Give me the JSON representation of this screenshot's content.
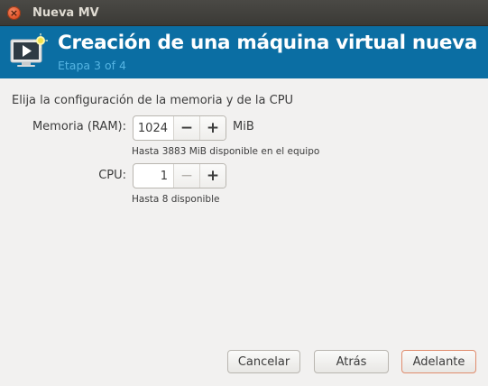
{
  "window": {
    "title": "Nueva MV",
    "close_glyph": "×"
  },
  "banner": {
    "title": "Creación de una máquina virtual nueva",
    "step": "Etapa 3 of 4",
    "icon": "vm-monitor-icon",
    "background": "#0b6ea3",
    "step_color": "#55b4e2"
  },
  "form": {
    "heading": "Elija la configuración de la memoria y de la CPU",
    "memory": {
      "label": "Memoria (RAM):",
      "value": "1024",
      "decrement": "−",
      "increment": "+",
      "unit": "MiB",
      "hint": "Hasta 3883 MiB disponible en el equipo"
    },
    "cpu": {
      "label": "CPU:",
      "value": "1",
      "decrement": "−",
      "increment": "+",
      "hint": "Hasta 8 disponible"
    }
  },
  "buttons": {
    "cancel": "Cancelar",
    "back": "Atrás",
    "forward": "Adelante"
  },
  "colors": {
    "titlebar": "#3b3a36",
    "close": "#e2542a",
    "primary_button_border": "#e08c6d"
  }
}
